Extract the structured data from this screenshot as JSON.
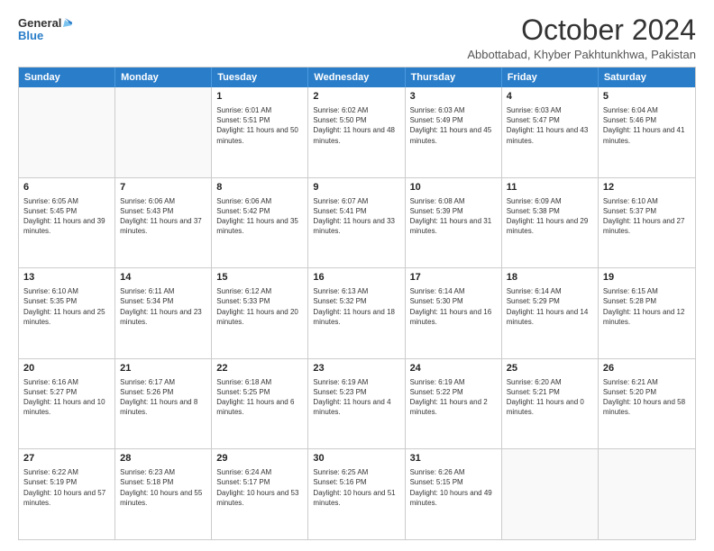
{
  "logo": {
    "line1": "General",
    "line2": "Blue"
  },
  "title": "October 2024",
  "subtitle": "Abbottabad, Khyber Pakhtunkhwa, Pakistan",
  "header_days": [
    "Sunday",
    "Monday",
    "Tuesday",
    "Wednesday",
    "Thursday",
    "Friday",
    "Saturday"
  ],
  "rows": [
    [
      {
        "day": "",
        "info": ""
      },
      {
        "day": "",
        "info": ""
      },
      {
        "day": "1",
        "info": "Sunrise: 6:01 AM\nSunset: 5:51 PM\nDaylight: 11 hours and 50 minutes."
      },
      {
        "day": "2",
        "info": "Sunrise: 6:02 AM\nSunset: 5:50 PM\nDaylight: 11 hours and 48 minutes."
      },
      {
        "day": "3",
        "info": "Sunrise: 6:03 AM\nSunset: 5:49 PM\nDaylight: 11 hours and 45 minutes."
      },
      {
        "day": "4",
        "info": "Sunrise: 6:03 AM\nSunset: 5:47 PM\nDaylight: 11 hours and 43 minutes."
      },
      {
        "day": "5",
        "info": "Sunrise: 6:04 AM\nSunset: 5:46 PM\nDaylight: 11 hours and 41 minutes."
      }
    ],
    [
      {
        "day": "6",
        "info": "Sunrise: 6:05 AM\nSunset: 5:45 PM\nDaylight: 11 hours and 39 minutes."
      },
      {
        "day": "7",
        "info": "Sunrise: 6:06 AM\nSunset: 5:43 PM\nDaylight: 11 hours and 37 minutes."
      },
      {
        "day": "8",
        "info": "Sunrise: 6:06 AM\nSunset: 5:42 PM\nDaylight: 11 hours and 35 minutes."
      },
      {
        "day": "9",
        "info": "Sunrise: 6:07 AM\nSunset: 5:41 PM\nDaylight: 11 hours and 33 minutes."
      },
      {
        "day": "10",
        "info": "Sunrise: 6:08 AM\nSunset: 5:39 PM\nDaylight: 11 hours and 31 minutes."
      },
      {
        "day": "11",
        "info": "Sunrise: 6:09 AM\nSunset: 5:38 PM\nDaylight: 11 hours and 29 minutes."
      },
      {
        "day": "12",
        "info": "Sunrise: 6:10 AM\nSunset: 5:37 PM\nDaylight: 11 hours and 27 minutes."
      }
    ],
    [
      {
        "day": "13",
        "info": "Sunrise: 6:10 AM\nSunset: 5:35 PM\nDaylight: 11 hours and 25 minutes."
      },
      {
        "day": "14",
        "info": "Sunrise: 6:11 AM\nSunset: 5:34 PM\nDaylight: 11 hours and 23 minutes."
      },
      {
        "day": "15",
        "info": "Sunrise: 6:12 AM\nSunset: 5:33 PM\nDaylight: 11 hours and 20 minutes."
      },
      {
        "day": "16",
        "info": "Sunrise: 6:13 AM\nSunset: 5:32 PM\nDaylight: 11 hours and 18 minutes."
      },
      {
        "day": "17",
        "info": "Sunrise: 6:14 AM\nSunset: 5:30 PM\nDaylight: 11 hours and 16 minutes."
      },
      {
        "day": "18",
        "info": "Sunrise: 6:14 AM\nSunset: 5:29 PM\nDaylight: 11 hours and 14 minutes."
      },
      {
        "day": "19",
        "info": "Sunrise: 6:15 AM\nSunset: 5:28 PM\nDaylight: 11 hours and 12 minutes."
      }
    ],
    [
      {
        "day": "20",
        "info": "Sunrise: 6:16 AM\nSunset: 5:27 PM\nDaylight: 11 hours and 10 minutes."
      },
      {
        "day": "21",
        "info": "Sunrise: 6:17 AM\nSunset: 5:26 PM\nDaylight: 11 hours and 8 minutes."
      },
      {
        "day": "22",
        "info": "Sunrise: 6:18 AM\nSunset: 5:25 PM\nDaylight: 11 hours and 6 minutes."
      },
      {
        "day": "23",
        "info": "Sunrise: 6:19 AM\nSunset: 5:23 PM\nDaylight: 11 hours and 4 minutes."
      },
      {
        "day": "24",
        "info": "Sunrise: 6:19 AM\nSunset: 5:22 PM\nDaylight: 11 hours and 2 minutes."
      },
      {
        "day": "25",
        "info": "Sunrise: 6:20 AM\nSunset: 5:21 PM\nDaylight: 11 hours and 0 minutes."
      },
      {
        "day": "26",
        "info": "Sunrise: 6:21 AM\nSunset: 5:20 PM\nDaylight: 10 hours and 58 minutes."
      }
    ],
    [
      {
        "day": "27",
        "info": "Sunrise: 6:22 AM\nSunset: 5:19 PM\nDaylight: 10 hours and 57 minutes."
      },
      {
        "day": "28",
        "info": "Sunrise: 6:23 AM\nSunset: 5:18 PM\nDaylight: 10 hours and 55 minutes."
      },
      {
        "day": "29",
        "info": "Sunrise: 6:24 AM\nSunset: 5:17 PM\nDaylight: 10 hours and 53 minutes."
      },
      {
        "day": "30",
        "info": "Sunrise: 6:25 AM\nSunset: 5:16 PM\nDaylight: 10 hours and 51 minutes."
      },
      {
        "day": "31",
        "info": "Sunrise: 6:26 AM\nSunset: 5:15 PM\nDaylight: 10 hours and 49 minutes."
      },
      {
        "day": "",
        "info": ""
      },
      {
        "day": "",
        "info": ""
      }
    ]
  ]
}
